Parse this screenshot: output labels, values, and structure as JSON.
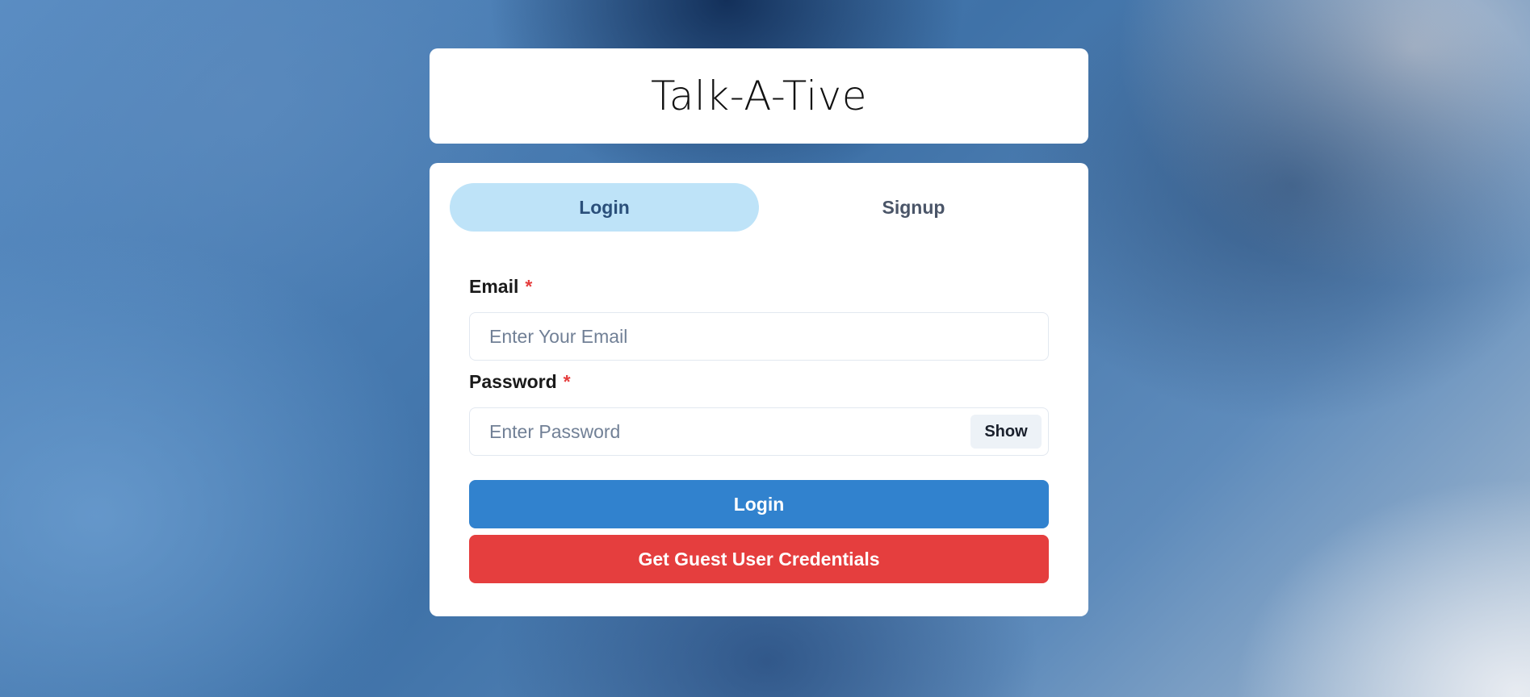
{
  "app": {
    "title": "Talk-A-Tive"
  },
  "tabs": [
    {
      "label": "Login",
      "active": true
    },
    {
      "label": "Signup",
      "active": false
    }
  ],
  "form": {
    "email": {
      "label": "Email",
      "required_marker": "*",
      "placeholder": "Enter Your Email",
      "value": ""
    },
    "password": {
      "label": "Password",
      "required_marker": "*",
      "placeholder": "Enter Password",
      "value": "",
      "toggle_label": "Show"
    },
    "login_button_label": "Login",
    "guest_button_label": "Get Guest User Credentials"
  },
  "colors": {
    "active_tab_bg": "#bee3f8",
    "primary_button": "#3182ce",
    "guest_button": "#e53e3e",
    "required_marker": "#e53e3e"
  }
}
